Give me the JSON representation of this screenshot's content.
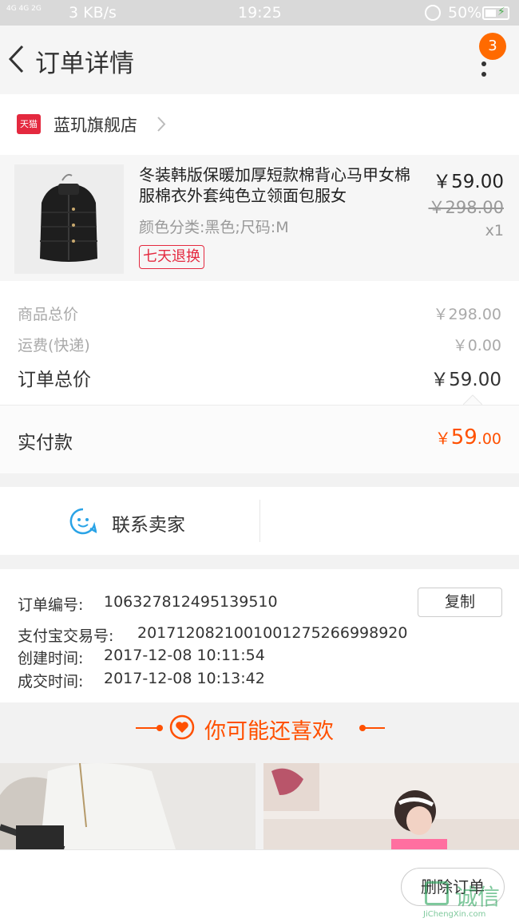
{
  "status_bar": {
    "network": "4G 4G 2G",
    "speed": "3 KB/s",
    "time": "19:25",
    "battery": "50%"
  },
  "header": {
    "title": "订单详情",
    "badge_count": "3"
  },
  "store": {
    "badge": "天猫",
    "name": "蓝玑旗舰店"
  },
  "product": {
    "title": "冬装韩版保暖加厚短款棉背心马甲女棉服棉衣外套纯色立领面包服女",
    "spec": "颜色分类:黑色;尺码:M",
    "tag": "七天退换",
    "price": "￥59.00",
    "original_price": "￥298.00",
    "quantity": "x1"
  },
  "summary": {
    "goods_total_label": "商品总价",
    "goods_total_value": "￥298.00",
    "shipping_label": "运费(快递)",
    "shipping_value": "￥0.00",
    "order_total_label": "订单总价",
    "order_total_value": "￥59.00"
  },
  "paid": {
    "label": "实付款",
    "currency": "￥",
    "integer": "59",
    "decimal": ".00"
  },
  "contact": {
    "label": "联系卖家"
  },
  "order_info": {
    "order_no_label": "订单编号:",
    "order_no": "106327812495139510",
    "copy_label": "复制",
    "alipay_label": "支付宝交易号:",
    "alipay_no": "2017120821001001275266998920",
    "created_label": "创建时间:",
    "created_time": "2017-12-08 10:11:54",
    "closed_label": "成交时间:",
    "closed_time": "2017-12-08 10:13:42"
  },
  "recommend": {
    "title": "你可能还喜欢"
  },
  "bottom": {
    "delete_label": "删除订单"
  },
  "watermark": {
    "main": "诚信",
    "sub": "JiChengXin.com"
  },
  "colors": {
    "accent": "#ff5000",
    "tmall_red": "#e4293f",
    "contact_blue": "#2aa3e6"
  }
}
